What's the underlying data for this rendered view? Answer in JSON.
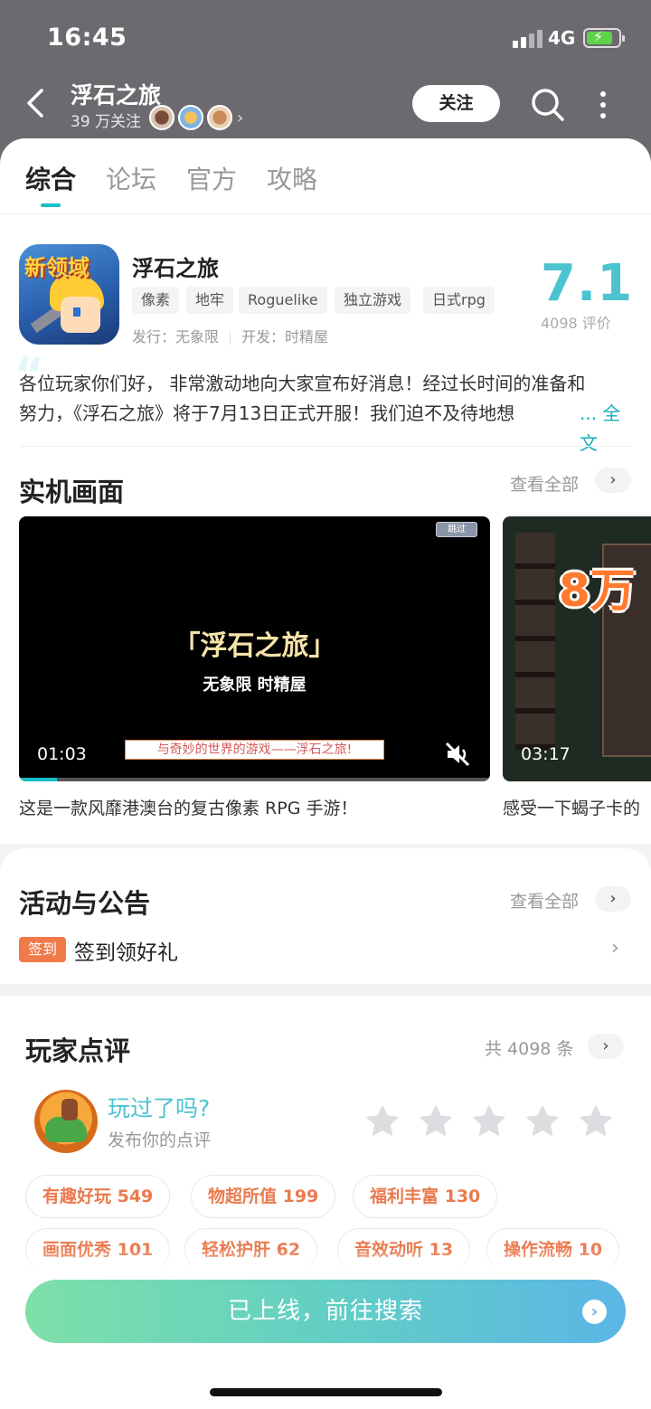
{
  "status_bar": {
    "time": "16:45",
    "network": "4G"
  },
  "nav": {
    "title": "浮石之旅",
    "followers": "39 万关注",
    "follow_label": "关注"
  },
  "tabs": [
    "综合",
    "论坛",
    "官方",
    "攻略"
  ],
  "game": {
    "name": "浮石之旅",
    "icon_text": "新领域",
    "tags": [
      "像素",
      "地牢",
      "Roguelike",
      "独立游戏",
      "日式rpg"
    ],
    "publisher": "发行：无象限",
    "developer": "开发：时精屋",
    "score": "7.1",
    "rating_count": "4098 评价"
  },
  "announcement": {
    "line1": "各位玩家你们好，  非常激动地向大家宣布好消息！经过长时间的准备和",
    "line2": "努力，《浮石之旅》将于7月13日正式开服！我们迫不及待地想",
    "more": "... 全文"
  },
  "screenshots": {
    "title": "实机画面",
    "see_all": "查看全部",
    "videos": [
      {
        "skip": "跳过",
        "headline": "「浮石之旅」",
        "subline": "无象限 时精屋",
        "banner": "与奇妙的世界的游戏——浮石之旅!",
        "duration": "01:03",
        "progress": 0.08,
        "caption": "这是一款风靡港澳台的复古像素 RPG 手游！"
      },
      {
        "overlay": "8万",
        "duration": "03:17",
        "caption": "感受一下蝎子卡的"
      }
    ]
  },
  "activity": {
    "title": "活动与公告",
    "see_all": "查看全部",
    "item_tag": "签到",
    "item_text": "签到领好礼"
  },
  "reviews": {
    "title": "玩家点评",
    "total": "共 4098 条",
    "prompt": "玩过了吗?",
    "post": "发布你的点评",
    "star_count": 5,
    "chips": [
      "有趣好玩 549",
      "物超所值 199",
      "福利丰富 130",
      "画面优秀 101",
      "轻松护肝 62",
      "音效动听 13",
      "操作流畅 10"
    ]
  },
  "cta": {
    "label": "已上线，前往搜索"
  },
  "colors": {
    "accent": "#4cc3d0",
    "tab_indicator": "#14c0c8",
    "chip_text": "#ea7a4e",
    "checkin_tag": "#f07a4a"
  }
}
